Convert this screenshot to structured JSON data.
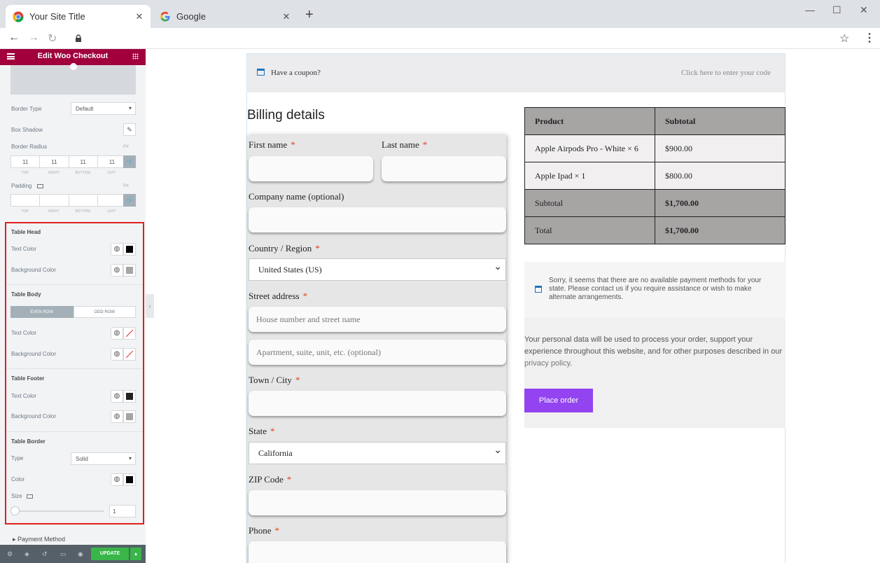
{
  "browser": {
    "tabs": [
      {
        "title": "Your Site Title"
      },
      {
        "title": "Google"
      }
    ],
    "close_glyph": "✕",
    "new_tab_glyph": "+",
    "window": {
      "minimize": "—",
      "maximize": "☐",
      "close": "✕"
    },
    "nav": {
      "back": "←",
      "forward": "→",
      "reload": "↻"
    },
    "star": "☆",
    "menu": "⋮"
  },
  "panel": {
    "title": "Edit Woo Checkout",
    "border_type": {
      "label": "Border Type",
      "value": "Default"
    },
    "box_shadow": {
      "label": "Box Shadow"
    },
    "border_radius": {
      "label": "Border Radius",
      "unit": "PX",
      "values": [
        "11",
        "11",
        "11",
        "11"
      ],
      "sides": [
        "TOP",
        "RIGHT",
        "BOTTOM",
        "LEFT"
      ]
    },
    "padding": {
      "label": "Padding",
      "unit": "PX",
      "values": [
        "",
        "",
        "",
        ""
      ],
      "sides": [
        "TOP",
        "RIGHT",
        "BOTTOM",
        "LEFT"
      ]
    },
    "table_head": {
      "title": "Table Head",
      "text_color_label": "Text Color",
      "text_color": "#000000",
      "bg_color_label": "Background Color",
      "bg_color": "#a7a4a4"
    },
    "table_body": {
      "title": "Table Body",
      "even_row": "EVEN ROW",
      "odd_row": "ODD ROW",
      "text_color_label": "Text Color",
      "bg_color_label": "Background Color"
    },
    "table_footer": {
      "title": "Table Footer",
      "text_color_label": "Text Color",
      "text_color": "#222222",
      "bg_color_label": "Background Color",
      "bg_color": "#a7a4a4"
    },
    "table_border": {
      "title": "Table Border",
      "type_label": "Type",
      "type_value": "Solid",
      "color_label": "Color",
      "color": "#000000",
      "size_label": "Size",
      "size_value": "1",
      "size_fraction": 0
    },
    "payment_method": "Payment Method",
    "update_label": "UPDATE",
    "highlight_color": "#e02020",
    "header_color": "#a1003c",
    "update_color": "#39b54a"
  },
  "site": {
    "coupon": {
      "text": "Have a coupon?",
      "link": "Click here to enter your code"
    },
    "billing_title": "Billing details",
    "fields": {
      "first_name": "First name",
      "last_name": "Last name",
      "company": "Company name (optional)",
      "country": "Country / Region",
      "country_value": "United States (US)",
      "street": "Street address",
      "street_placeholder": "House number and street name",
      "street2_placeholder": "Apartment, suite, unit, etc. (optional)",
      "city": "Town / City",
      "state": "State",
      "state_value": "California",
      "zip": "ZIP Code",
      "phone": "Phone",
      "required_mark": "*"
    },
    "order": {
      "headers": [
        "Product",
        "Subtotal"
      ],
      "items": [
        {
          "name": "Apple Airpods Pro - White",
          "qty": "× 6",
          "subtotal": "$900.00"
        },
        {
          "name": "Apple Ipad",
          "qty": "× 1",
          "subtotal": "$800.00"
        }
      ],
      "subtotal_label": "Subtotal",
      "subtotal_value": "$1,700.00",
      "total_label": "Total",
      "total_value": "$1,700.00"
    },
    "payment_notice": "Sorry, it seems that there are no available payment methods for your state. Please contact us if you require assistance or wish to make alternate arrangements.",
    "privacy_text": "Your personal data will be used to process your order, support your experience throughout this website, and for other purposes described in our",
    "privacy_link": "privacy policy",
    "privacy_end": ".",
    "place_order": "Place order",
    "accent_color": "#9343f0"
  }
}
